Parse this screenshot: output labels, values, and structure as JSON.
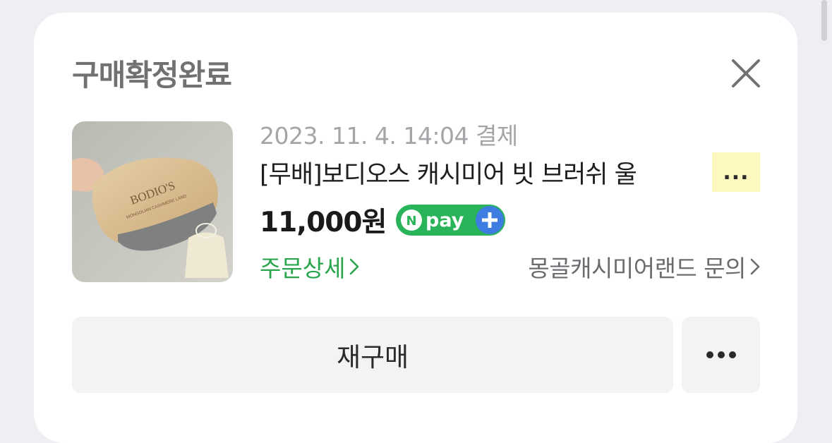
{
  "card": {
    "title": "구매확정완료",
    "close_icon": "close-icon"
  },
  "order": {
    "date": "2023. 11. 4. 14:04 결제",
    "product_name": "[무배]보디오스 캐시미어 빗 브러쉬 울",
    "more_indicator": "...",
    "price": "11,000원",
    "payment_badge": "Npay+",
    "thumbnail_brand_text": "BODIO'S",
    "thumbnail_sub_text": "MONGOLIAN CASHMERE LAND",
    "order_detail_label": "주문상세",
    "seller_inquiry_label": "몽골캐시미어랜드 문의"
  },
  "actions": {
    "rebuy_label": "재구매",
    "more_icon": "more-dots-icon"
  },
  "colors": {
    "accent_green": "#2aa54d",
    "npay_green": "#2ab45a",
    "highlight_yellow": "#fdf8c0"
  }
}
